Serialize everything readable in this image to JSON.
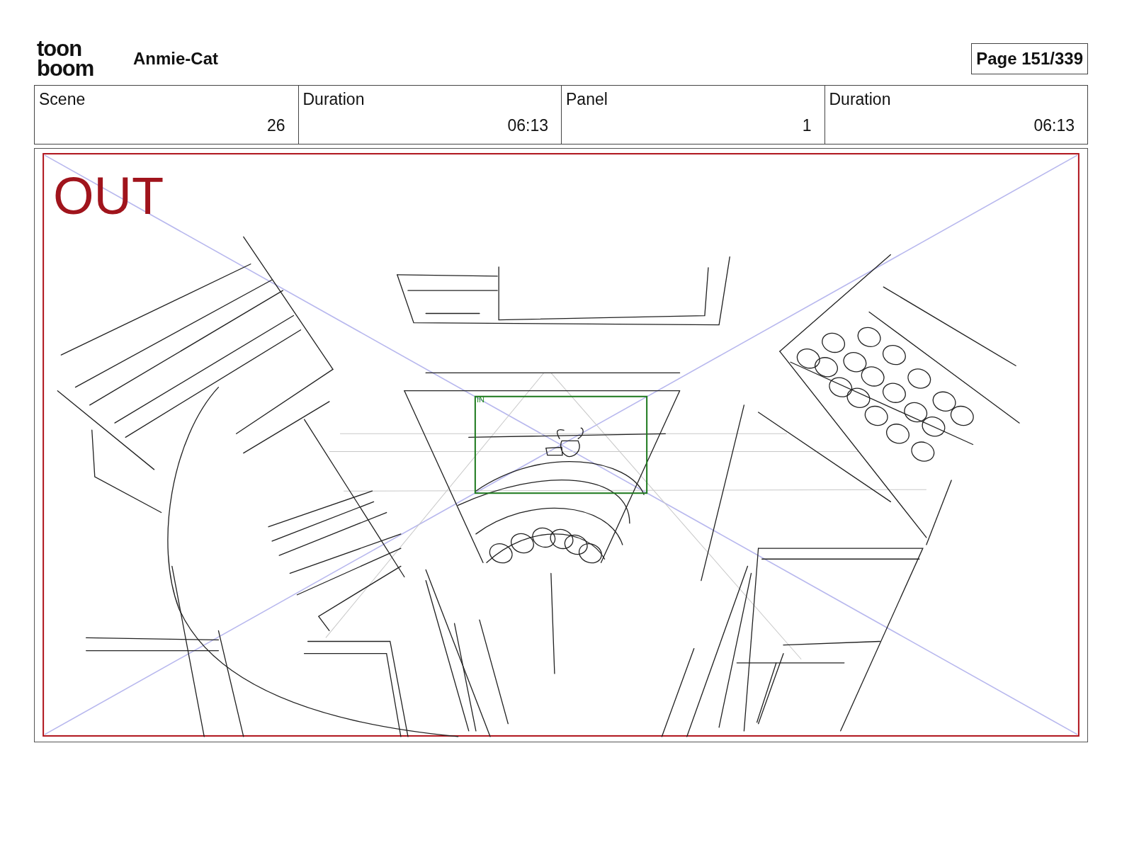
{
  "logo": {
    "lines": [
      "toon",
      "boom"
    ]
  },
  "project_title": "Anmie-Cat",
  "page_label": "Page 151/339",
  "info_fields": [
    {
      "label": "Scene",
      "value": "26"
    },
    {
      "label": "Duration",
      "value": "06:13"
    },
    {
      "label": "Panel",
      "value": "1"
    },
    {
      "label": "Duration",
      "value": "06:13"
    }
  ],
  "panel": {
    "out_label": "OUT",
    "in_label": "IN"
  }
}
